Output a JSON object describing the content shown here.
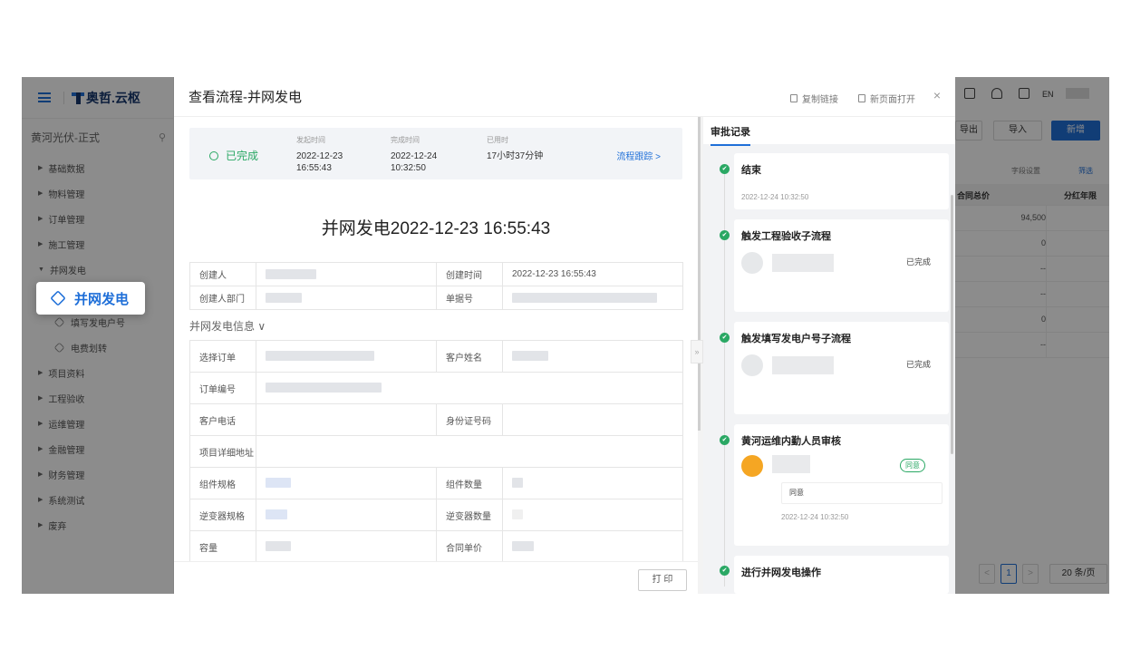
{
  "app": {
    "logo_text": "奥哲.云枢",
    "tenant": "黄河光伏-正式",
    "lang": "EN"
  },
  "sidebar": {
    "items": [
      {
        "label": "基础数据"
      },
      {
        "label": "物料管理"
      },
      {
        "label": "订单管理"
      },
      {
        "label": "施工管理"
      },
      {
        "label": "并网发电"
      }
    ],
    "active_sub": "并网发电",
    "sub_items": [
      {
        "label": "填写发电户号"
      },
      {
        "label": "电费划转"
      }
    ],
    "items_after": [
      {
        "label": "项目资料"
      },
      {
        "label": "工程验收"
      },
      {
        "label": "运维管理"
      },
      {
        "label": "金融管理"
      },
      {
        "label": "财务管理"
      },
      {
        "label": "系统测试"
      },
      {
        "label": "废弃"
      }
    ]
  },
  "background": {
    "export_label": "导出",
    "import_label": "导入",
    "new_label": "新增",
    "field_settings": "字段设置",
    "filter": "筛选",
    "col_total": "合同总价",
    "col_years": "分红年限",
    "rows": [
      "94,500",
      "0",
      "--",
      "--",
      "0",
      "--"
    ],
    "page": "1",
    "page_size": "20 条/页"
  },
  "modal": {
    "title": "查看流程-并网发电",
    "copy_link": "复制链接",
    "open_new": "新页面打开",
    "close": "×",
    "status": {
      "state": "已完成",
      "start_label": "发起时间",
      "start_date": "2022-12-23",
      "start_time": "16:55:43",
      "end_label": "完成时间",
      "end_date": "2022-12-24",
      "end_time": "10:32:50",
      "used_label": "已用时",
      "used_value": "17小时37分钟",
      "track": "流程跟踪 >"
    },
    "doc_title": "并网发电2022-12-23 16:55:43",
    "meta": {
      "creator_label": "创建人",
      "created_time_label": "创建时间",
      "created_time_value": "2022-12-23 16:55:43",
      "dept_label": "创建人部门",
      "doc_no_label": "单据号"
    },
    "section_title": "并网发电信息 ∨",
    "fields": [
      [
        "选择订单",
        "客户姓名"
      ],
      [
        "订单编号",
        ""
      ],
      [
        "客户电话",
        "身份证号码"
      ],
      [
        "项目详细地址",
        ""
      ],
      [
        "组件规格",
        "组件数量"
      ],
      [
        "逆变器规格",
        "逆变器数量"
      ],
      [
        "容量",
        "合同单价"
      ]
    ],
    "print": "打 印",
    "approval": {
      "tab": "审批记录",
      "nodes": [
        {
          "title": "结束",
          "time": "2022-12-24 10:32:50"
        },
        {
          "title": "触发工程验收子流程",
          "status": "已完成"
        },
        {
          "title": "触发填写发电户号子流程",
          "status": "已完成"
        },
        {
          "title": "黄河运维内勤人员审核",
          "badge": "同意",
          "comment": "同意",
          "time": "2022-12-24 10:32:50"
        },
        {
          "title": "进行并网发电操作"
        }
      ]
    }
  }
}
